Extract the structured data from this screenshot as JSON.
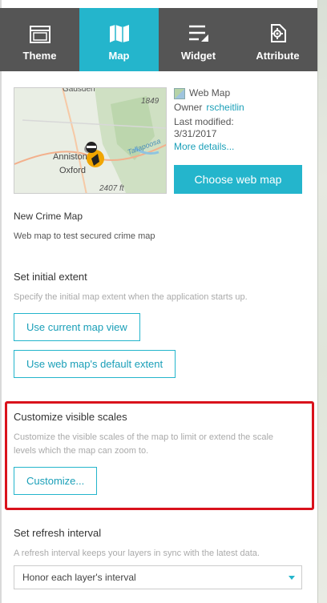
{
  "tabs": [
    {
      "label": "Theme",
      "icon": "theme-icon"
    },
    {
      "label": "Map",
      "icon": "map-icon",
      "active": true
    },
    {
      "label": "Widget",
      "icon": "widget-icon"
    },
    {
      "label": "Attribute",
      "icon": "attribute-icon"
    }
  ],
  "colors": {
    "accent": "#24b5cc",
    "tabbar": "#555555",
    "highlight": "#d9121c"
  },
  "webmap": {
    "type_label": "Web Map",
    "owner_label": "Owner",
    "owner_name": "rscheitlin",
    "last_modified_label": "Last modified:",
    "last_modified": "3/31/2017",
    "more_details": "More details...",
    "choose_button": "Choose web map",
    "thumbnail_labels": {
      "top": "Gadsden",
      "right_num": "1849",
      "lake": "Tallapoosa",
      "city1": "Anniston",
      "city2": "Oxford",
      "bottom": "2407 ft"
    },
    "title": "New Crime Map",
    "description": "Web map to test secured crime map"
  },
  "initial_extent": {
    "title": "Set initial extent",
    "description": "Specify the initial map extent when the application starts up.",
    "current_view_button": "Use current map view",
    "default_extent_button": "Use web map's default extent"
  },
  "visible_scales": {
    "title": "Customize visible scales",
    "description": "Customize the visible scales of the map to limit or extend the scale levels which the map can zoom to.",
    "customize_button": "Customize..."
  },
  "refresh": {
    "title": "Set refresh interval",
    "description": "A refresh interval keeps your layers in sync with the latest data.",
    "selected_option": "Honor each layer's interval"
  }
}
